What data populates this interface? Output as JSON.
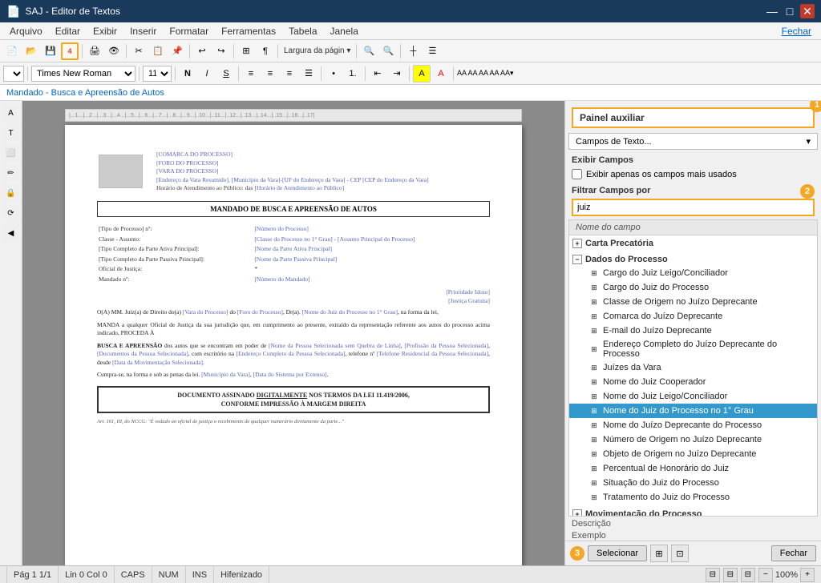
{
  "app": {
    "title": "SAJ - Editor de Textos",
    "close_btn": "✕",
    "min_btn": "—",
    "max_btn": "□"
  },
  "menu": {
    "items": [
      "Arquivo",
      "Editar",
      "Exibir",
      "Inserir",
      "Formatar",
      "Ferramentas",
      "Tabela",
      "Janela"
    ],
    "right": "Fechar"
  },
  "formatting": {
    "font_name": "Times New Roman",
    "font_size": "11",
    "bold": "N",
    "italic": "I",
    "underline": "S"
  },
  "breadcrumb": "Mandado - Busca e Apreensão de Autos",
  "panel": {
    "title": "Painel auxiliar",
    "dropdown_label": "Campos de Texto...",
    "exibir_label": "Exibir Campos",
    "checkbox_label": "Exibir apenas os campos mais usados",
    "filter_label": "Filtrar Campos por",
    "filter_value": "juiz",
    "tree_column": "Nome do campo",
    "callout1": "1",
    "callout2": "2",
    "callout3": "3",
    "groups": [
      {
        "name": "Carta Precatória",
        "expanded": false,
        "items": []
      },
      {
        "name": "Dados do Processo",
        "expanded": true,
        "items": [
          "Cargo do Juiz Leigo/Conciliador",
          "Cargo do Juiz do Processo",
          "Classe de Origem no Juízo Deprecante",
          "Comarca do Juízo Deprecante",
          "E-mail do Juízo Deprecante",
          "Endereço Completo do Juízo Deprecante do Processo",
          "Juízes da Vara",
          "Nome do Juiz Cooperador",
          "Nome do Juiz Leigo/Conciliador",
          "Nome do Juiz do Processo no 1° Grau",
          "Nome do Juízo Deprecante do Processo",
          "Número de Origem no Juízo Deprecante",
          "Objeto de Origem no Juízo Deprecante",
          "Percentual de Honorário do Juiz",
          "Situação do Juiz do Processo",
          "Tratamento do Juiz do Processo"
        ],
        "selected_index": 9
      },
      {
        "name": "Movimentação do Processo",
        "expanded": false,
        "items": []
      },
      {
        "name": "Variáveis de Sistema",
        "expanded": false,
        "items": []
      }
    ],
    "description_label": "Descrição",
    "example_label": "Exemplo",
    "footer": {
      "select_btn": "Selecionar",
      "fechar_btn": "Fechar"
    }
  },
  "document": {
    "header_fields": [
      "[COMARCA DO PROCESSO]",
      "[FORO DO PROCESSO]",
      "[VARA DO PROCESSO]",
      "[Endereço da Vara Resumido], [Município da Vara]-[UF do Endereço da Vara] - CEP [CEP do Endereço da Vara]",
      "Horário de Atendimento ao Público: das [Horário de Atendimento ao Público]"
    ],
    "title": "MANDADO DE BUSCA E APREENSÃO DE AUTOS",
    "body_lines": [
      "[Tipo de Processo] nº:    [Número do Processo]",
      "Classe - Assunto:          [Classe do Processo no 1° Grau] - [Assunto Principal do Processo]",
      "[Tipo Completo da Parte Ativa Principal]:    [Nome da Parte Ativa Principal]",
      "[Tipo Completo da Parte Passiva Principal]:  [Nome da Parte Passiva Principal]",
      "Oficial de Justiça:    *",
      "Mandado nº:            [Número do Mandado]",
      "[Prioridade Idoso]",
      "[Justiça Gratuita]"
    ],
    "paragraph1": "O(A) MM. Juiz(a) de Direito do(a) [Vara do Processo] do [Foro do Processo], Dr(a). [Nome do Juiz do Processo no 1° Grau], na forma da lei,",
    "paragraph2": "MANDA a qualquer Oficial de Justiça da sua jurisdição que, em cumprimento ao presente, extraído da representação referente aos autos do processo acima indicado, PROCEDA À",
    "paragraph3_bold": "BUSCA E APREENSÃO",
    "paragraph3": "dos autos que se encontram em poder de [Nome da Pessoa Selecionada sem Quebra de Linha], [Profissão da Pessoa Selecionada], [Documentos da Pessoa Selecionada], com escritório na [Endereço Completo da Pessoa Selecionada], telefone nº [Telefone Residencial da Pessoa Selecionada], desde [Data da Movimentação Selecionada].",
    "paragraph4": "Cumpra-se, na forma e sob as penas da lei. [Município da Vara], [Data do Sistema por Extenso].",
    "footer_text": "DOCUMENTO ASSINADO DIGITALMENTE NOS TERMOS DA LEI 11.419/2006, CONFORME IMPRESSÃO À MARGEM DIREITA"
  },
  "status_bar": {
    "page": "Pág 1",
    "total": "1/1",
    "position": "Lin 0  Col 0",
    "caps": "CAPS",
    "num": "NUM",
    "ins": "INS",
    "hifenizado": "Hifenizado"
  },
  "icons": {
    "expand_plus": "+",
    "expand_minus": "−",
    "tree_field": "⊞",
    "chevron_down": "▾",
    "bold": "B",
    "italic": "I",
    "underline": "U"
  }
}
